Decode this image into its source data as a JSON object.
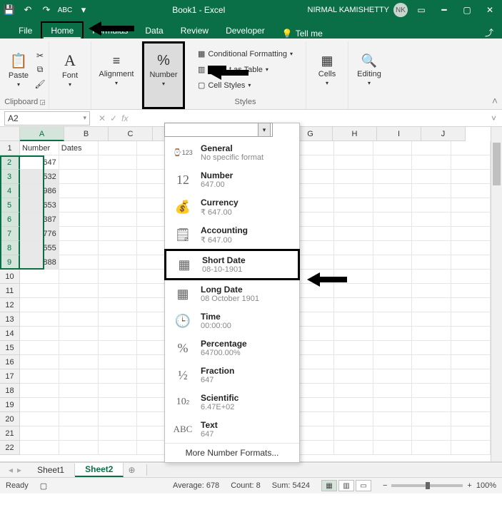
{
  "titlebar": {
    "title": "Book1 - Excel",
    "user": "NIRMAL KAMISHETTY",
    "initials": "NK"
  },
  "tabs": {
    "file": "File",
    "home": "Home",
    "formulas": "Formulas",
    "data": "Data",
    "review": "Review",
    "developer": "Developer",
    "tellme": "Tell me"
  },
  "ribbon": {
    "paste": "Paste",
    "clipboard": "Clipboard",
    "font": "Font",
    "alignment": "Alignment",
    "number": "Number",
    "cond_fmt": "Conditional Formatting",
    "as_table": "t as Table",
    "cell_styles": "Cell Styles",
    "styles": "Styles",
    "cells": "Cells",
    "editing": "Editing"
  },
  "namebox": "A2",
  "grid": {
    "columns": [
      "A",
      "B",
      "C",
      "",
      "",
      "G",
      "H",
      "I",
      "J"
    ],
    "header_a": "Number",
    "header_b": "Dates",
    "data_a": [
      "647",
      "532",
      "986",
      "653",
      "387",
      "776",
      "555",
      "888"
    ]
  },
  "formats": {
    "general_t": "General",
    "general_s": "No specific format",
    "number_t": "Number",
    "number_s": "647.00",
    "currency_t": "Currency",
    "currency_s": "₹ 647.00",
    "accounting_t": "Accounting",
    "accounting_s": "₹ 647.00",
    "shortdate_t": "Short Date",
    "shortdate_s": "08-10-1901",
    "longdate_t": "Long Date",
    "longdate_s": "08 October 1901",
    "time_t": "Time",
    "time_s": "00:00:00",
    "percent_t": "Percentage",
    "percent_s": "64700.00%",
    "fraction_t": "Fraction",
    "fraction_s": "647",
    "sci_t": "Scientific",
    "sci_s": "6.47E+02",
    "text_t": "Text",
    "text_s": "647",
    "more": "More Number Formats...",
    "more_key": "M"
  },
  "sheets": {
    "s1": "Sheet1",
    "s2": "Sheet2"
  },
  "status": {
    "ready": "Ready",
    "avg": "Average: 678",
    "count": "Count: 8",
    "sum": "Sum: 5424",
    "zoom": "100%"
  }
}
